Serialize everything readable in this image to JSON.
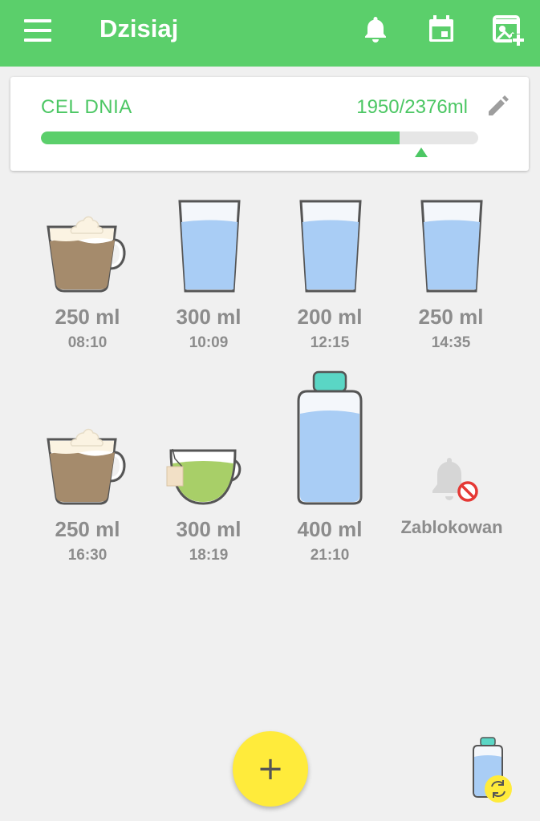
{
  "appbar": {
    "title": "Dzisiaj",
    "icons": [
      "menu-icon",
      "bell-icon",
      "calendar-icon",
      "add-photo-icon"
    ],
    "color": "#5bcf6b"
  },
  "goal": {
    "label": "CEL DNIA",
    "amount": "1950/2376ml",
    "progress": 0.82,
    "icon": "pencil-icon"
  },
  "drinks": [
    {
      "type": "coffee",
      "volume": "250 ml",
      "time": "08:10"
    },
    {
      "type": "water",
      "volume": "300 ml",
      "time": "10:09"
    },
    {
      "type": "water",
      "volume": "200 ml",
      "time": "12:15"
    },
    {
      "type": "water",
      "volume": "250 ml",
      "time": "14:35"
    },
    {
      "type": "coffee",
      "volume": "250 ml",
      "time": "16:30"
    },
    {
      "type": "tea",
      "volume": "300 ml",
      "time": "18:19"
    },
    {
      "type": "bottle",
      "volume": "400 ml",
      "time": "21:10"
    }
  ],
  "reminder": {
    "label": "Zablokowan",
    "icon": "bell-blocked-icon"
  },
  "fab": {
    "label": "+",
    "color": "#ffeb3b"
  },
  "cup_switcher": {
    "icon": "bottle-switch-icon"
  }
}
